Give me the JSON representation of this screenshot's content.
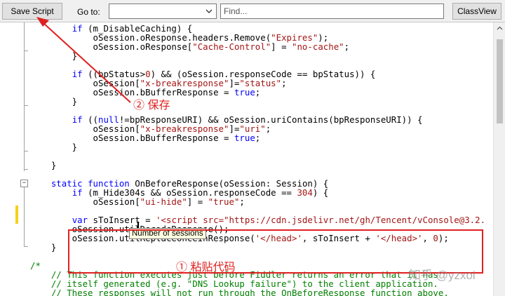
{
  "toolbar": {
    "save_label": "Save Script",
    "goto_label": "Go to:",
    "goto_selected": "",
    "find_placeholder": "Find...",
    "classview_label": "ClassView"
  },
  "code_lines": [
    {
      "segments": [
        [
          "        ",
          ""
        ],
        [
          "if",
          "kw"
        ],
        [
          " (m_DisableCaching) {",
          ""
        ]
      ]
    },
    {
      "segments": [
        [
          "            oSession.oResponse.headers.Remove(",
          ""
        ],
        [
          "\"Expires\"",
          "st"
        ],
        [
          ");",
          ""
        ]
      ]
    },
    {
      "segments": [
        [
          "            oSession.oResponse[",
          ""
        ],
        [
          "\"Cache-Control\"",
          "st"
        ],
        [
          "] = ",
          ""
        ],
        [
          "\"no-cache\"",
          "st"
        ],
        [
          ";",
          ""
        ]
      ]
    },
    {
      "segments": [
        [
          "        }",
          ""
        ]
      ]
    },
    {
      "segments": [
        [
          "",
          ""
        ]
      ]
    },
    {
      "segments": [
        [
          "        ",
          ""
        ],
        [
          "if",
          "kw"
        ],
        [
          " ((bpStatus>",
          ""
        ],
        [
          "0",
          "st"
        ],
        [
          ") && (oSession.responseCode == bpStatus)) {",
          ""
        ]
      ]
    },
    {
      "segments": [
        [
          "            oSession[",
          ""
        ],
        [
          "\"x-breakresponse\"",
          "st"
        ],
        [
          "]=",
          ""
        ],
        [
          "\"status\"",
          "st"
        ],
        [
          ";",
          ""
        ]
      ]
    },
    {
      "segments": [
        [
          "            oSession.bBufferResponse = ",
          ""
        ],
        [
          "true",
          "kw"
        ],
        [
          ";",
          ""
        ]
      ]
    },
    {
      "segments": [
        [
          "        }",
          ""
        ]
      ]
    },
    {
      "segments": [
        [
          "",
          ""
        ]
      ]
    },
    {
      "segments": [
        [
          "        ",
          ""
        ],
        [
          "if",
          "kw"
        ],
        [
          " ((",
          ""
        ],
        [
          "null",
          "kw"
        ],
        [
          "!=bpResponseURI) && oSession.uriContains(bpResponseURI)) {",
          ""
        ]
      ]
    },
    {
      "segments": [
        [
          "            oSession[",
          ""
        ],
        [
          "\"x-breakresponse\"",
          "st"
        ],
        [
          "]=",
          ""
        ],
        [
          "\"uri\"",
          "st"
        ],
        [
          ";",
          ""
        ]
      ]
    },
    {
      "segments": [
        [
          "            oSession.bBufferResponse = ",
          ""
        ],
        [
          "true",
          "kw"
        ],
        [
          ";",
          ""
        ]
      ]
    },
    {
      "segments": [
        [
          "        }",
          ""
        ]
      ]
    },
    {
      "segments": [
        [
          "",
          ""
        ]
      ]
    },
    {
      "segments": [
        [
          "    }",
          ""
        ]
      ]
    },
    {
      "segments": [
        [
          "",
          ""
        ]
      ]
    },
    {
      "segments": [
        [
          "    ",
          ""
        ],
        [
          "static",
          "kw"
        ],
        [
          " ",
          ""
        ],
        [
          "function",
          "kw"
        ],
        [
          " OnBeforeResponse(oSession: Session) {",
          ""
        ]
      ]
    },
    {
      "segments": [
        [
          "        ",
          ""
        ],
        [
          "if",
          "kw"
        ],
        [
          " (m_Hide304s && oSession.responseCode == ",
          ""
        ],
        [
          "304",
          "st"
        ],
        [
          ") {",
          ""
        ]
      ]
    },
    {
      "segments": [
        [
          "            oSession[",
          ""
        ],
        [
          "\"ui-hide\"",
          "st"
        ],
        [
          "] = ",
          ""
        ],
        [
          "\"true\"",
          "st"
        ],
        [
          ";",
          ""
        ]
      ]
    },
    {
      "segments": [
        [
          "        ",
          ""
        ]
      ]
    },
    {
      "segments": [
        [
          "        ",
          ""
        ],
        [
          "var",
          "kw"
        ],
        [
          " sToInsert = ",
          ""
        ],
        [
          "'<script src=\"https://cdn.jsdelivr.net/gh/Tencent/vConsole@3.2.",
          "st"
        ]
      ]
    },
    {
      "segments": [
        [
          "        oSession.utilDecodeResponse();",
          ""
        ]
      ]
    },
    {
      "segments": [
        [
          "        oSession.utilReplaceOnceInResponse(",
          ""
        ],
        [
          "'</head>'",
          "st"
        ],
        [
          ", sToInsert + ",
          ""
        ],
        [
          "'</head>'",
          "st"
        ],
        [
          ", ",
          ""
        ],
        [
          "0",
          "st"
        ],
        [
          ");",
          ""
        ]
      ]
    },
    {
      "segments": [
        [
          "    }",
          ""
        ]
      ]
    },
    {
      "segments": [
        [
          "",
          ""
        ]
      ]
    },
    {
      "segments": [
        [
          "/*",
          "cm"
        ]
      ]
    },
    {
      "segments": [
        [
          "    // This function executes just before Fiddler returns an error that it has",
          "cm"
        ]
      ]
    },
    {
      "segments": [
        [
          "    // itself generated (e.g. \"DNS Lookup failure\") to the client application.",
          "cm"
        ]
      ]
    },
    {
      "segments": [
        [
          "    // These responses will not run through the OnBeforeResponse function above.",
          "cm"
        ]
      ]
    }
  ],
  "tooltip": "Number of sessions",
  "annotations": {
    "save": "② 保存",
    "paste": "① 粘贴代码",
    "watermark": "知乎 @yzxoi"
  },
  "colors": {
    "annotation": "#e02020",
    "keyword": "#0000ff",
    "string": "#a31515",
    "comment": "#008000"
  }
}
